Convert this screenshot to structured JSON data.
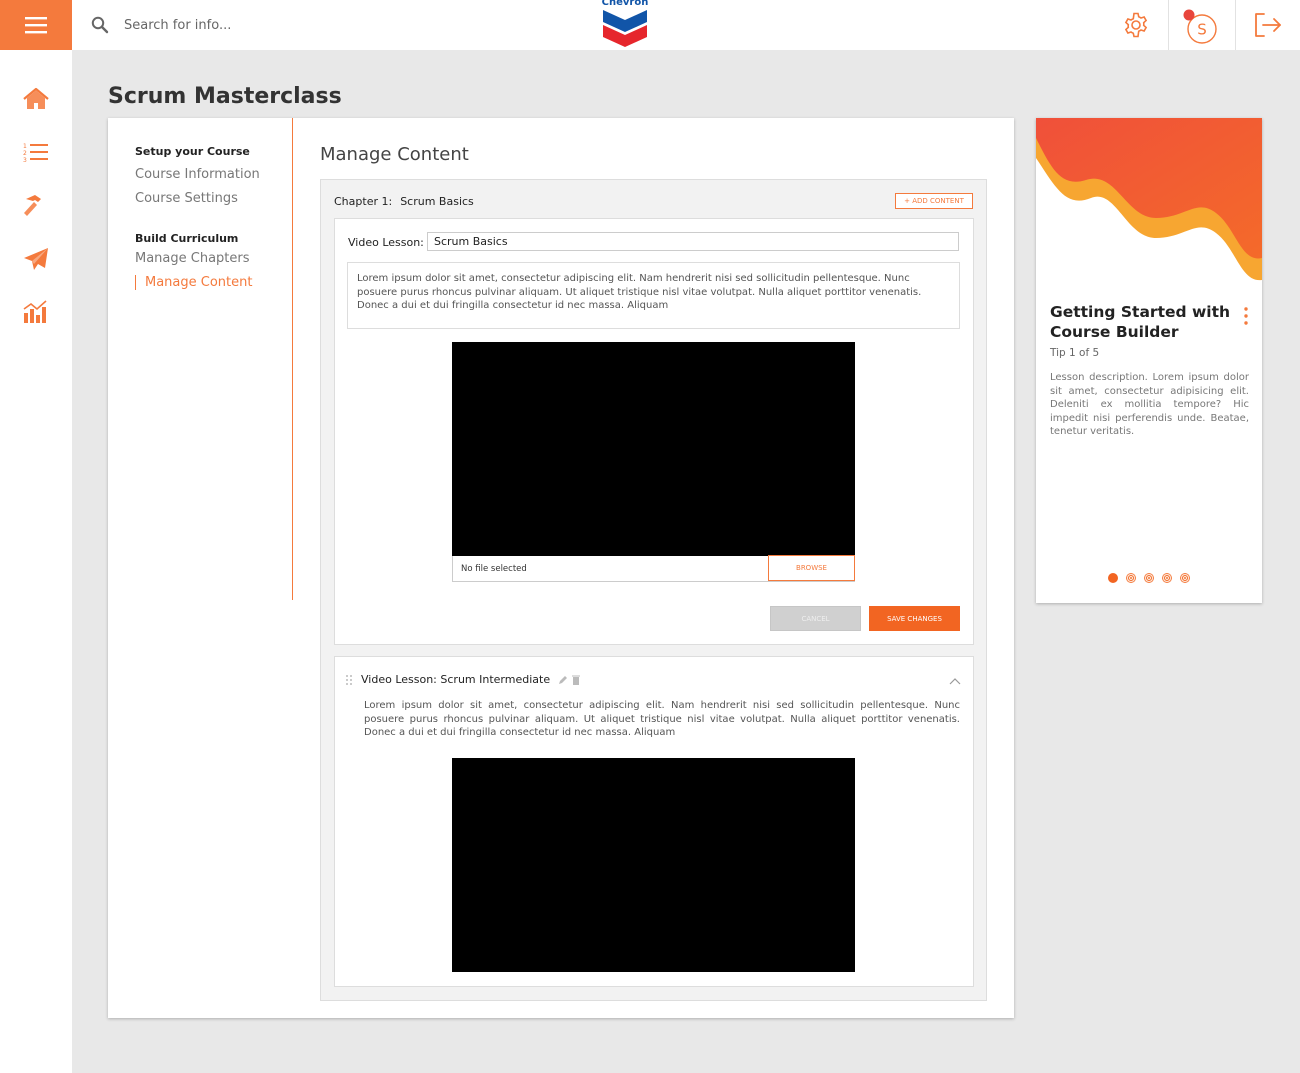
{
  "header": {
    "search_placeholder": "Search for info...",
    "logo_text": "Chevron"
  },
  "rail": {
    "items": [
      "home",
      "curriculum-list",
      "build",
      "publish",
      "analytics"
    ]
  },
  "page": {
    "title": "Scrum Masterclass"
  },
  "sidenav": {
    "section1_heading": "Setup your Course",
    "section1_links": [
      "Course Information",
      "Course Settings"
    ],
    "section2_heading": "Build Curriculum",
    "section2_links": [
      "Manage Chapters",
      "Manage Content"
    ],
    "active": "Manage Content"
  },
  "content": {
    "title": "Manage Content",
    "chapter_prefix": "Chapter 1:",
    "chapter_name": "Scrum Basics",
    "add_content_label": "+ ADD CONTENT",
    "lesson1": {
      "label": "Video Lesson:",
      "title_value": "Scrum Basics",
      "description": "Lorem ipsum dolor sit amet, consectetur adipiscing elit. Nam hendrerit nisi sed sollicitudin pellentesque. Nunc posuere purus rhoncus pulvinar aliquam. Ut aliquet tristique nisl vitae volutpat. Nulla aliquet porttitor venenatis. Donec a dui et dui fringilla consectetur id nec massa. Aliquam",
      "file_status": "No file selected",
      "browse_label": "BROWSE",
      "cancel_label": "CANCEL",
      "save_label": "SAVE CHANGES"
    },
    "lesson2": {
      "title": "Video Lesson: Scrum Intermediate",
      "description": "Lorem ipsum dolor sit amet, consectetur adipiscing elit. Nam hendrerit nisi sed sollicitudin pellentesque. Nunc posuere purus rhoncus pulvinar aliquam. Ut aliquet tristique nisl vitae volutpat. Nulla aliquet porttitor venenatis. Donec a dui et dui fringilla consectetur id nec massa. Aliquam"
    }
  },
  "tip": {
    "title": "Getting Started with Course Builder",
    "count": "Tip 1 of 5",
    "description": "Lesson description. Lorem ipsum dolor sit amet, consectetur adipisicing elit. Deleniti ex mollitia tempore? Hic impedit nisi perferendis unde. Beatae, tenetur veritatis.",
    "total": 5,
    "current": 1
  },
  "colors": {
    "accent": "#f47a3d",
    "primary_button": "#f26522",
    "logo_blue": "#1155a8",
    "logo_red": "#e6262c"
  }
}
